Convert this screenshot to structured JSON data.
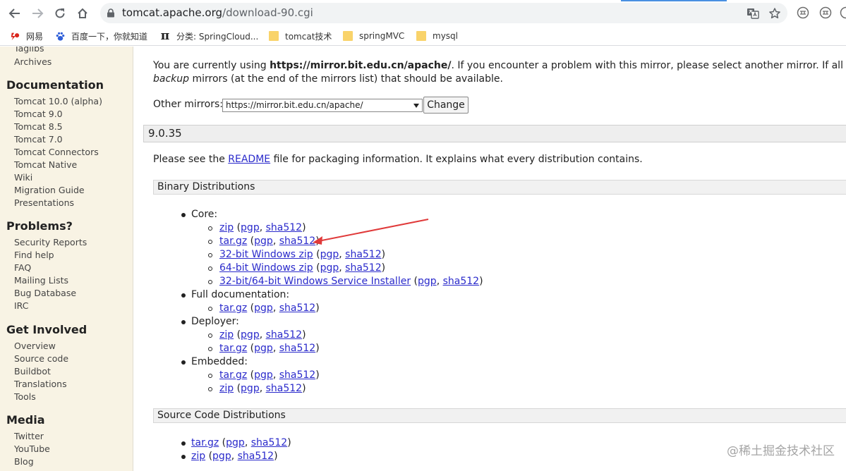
{
  "browser": {
    "url_host": "tomcat.apache.org",
    "url_path": "/download-90.cgi"
  },
  "bookmarks": [
    {
      "label": "网易"
    },
    {
      "label": "百度一下，你就知道"
    },
    {
      "label": "分类: SpringCloud..."
    },
    {
      "label": "tomcat技术"
    },
    {
      "label": "springMVC"
    },
    {
      "label": "mysql"
    }
  ],
  "sidebar": {
    "top_items": [
      "Taglibs",
      "Archives"
    ],
    "sections": [
      {
        "heading": "Documentation",
        "items": [
          "Tomcat 10.0 (alpha)",
          "Tomcat 9.0",
          "Tomcat 8.5",
          "Tomcat 7.0",
          "Tomcat Connectors",
          "Tomcat Native",
          "Wiki",
          "Migration Guide",
          "Presentations"
        ]
      },
      {
        "heading": "Problems?",
        "items": [
          "Security Reports",
          "Find help",
          "FAQ",
          "Mailing Lists",
          "Bug Database",
          "IRC"
        ]
      },
      {
        "heading": "Get Involved",
        "items": [
          "Overview",
          "Source code",
          "Buildbot",
          "Translations",
          "Tools"
        ]
      },
      {
        "heading": "Media",
        "items": [
          "Twitter",
          "YouTube",
          "Blog"
        ]
      }
    ]
  },
  "main": {
    "mirror_intro": "You are currently using",
    "mirror_url": "https://mirror.bit.edu.cn/apache/",
    "mirror_rest": ". If you encounter a problem with this mirror, please select another mirror. If all mirrors are",
    "mirror_line2_em": "backup",
    "mirror_line2_rest": " mirrors (at the end of the mirrors list) that should be available.",
    "other_mirrors_label": "Other mirrors:",
    "mirror_select_value": "https://mirror.bit.edu.cn/apache/",
    "change_button": "Change",
    "version": "9.0.35",
    "readme_pre": "Please see the ",
    "readme_link": "README",
    "readme_post": " file for packaging information. It explains what every distribution contains.",
    "binary_heading": "Binary Distributions",
    "core_label": "Core:",
    "full_doc_label": "Full documentation:",
    "deployer_label": "Deployer:",
    "embedded_label": "Embedded:",
    "source_heading": "Source Code Distributions",
    "link_zip": "zip",
    "link_targz": "tar.gz",
    "link_pgp": "pgp",
    "link_sha512": "sha512",
    "link_win32": "32-bit Windows zip",
    "link_win64": "64-bit Windows zip",
    "link_installer": "32-bit/64-bit Windows Service Installer"
  },
  "watermark": "@稀土掘金技术社区",
  "colors": {
    "link": "#2a2acb",
    "sidebar_bg": "#f8f3e4",
    "arrow": "#e03a3a"
  }
}
